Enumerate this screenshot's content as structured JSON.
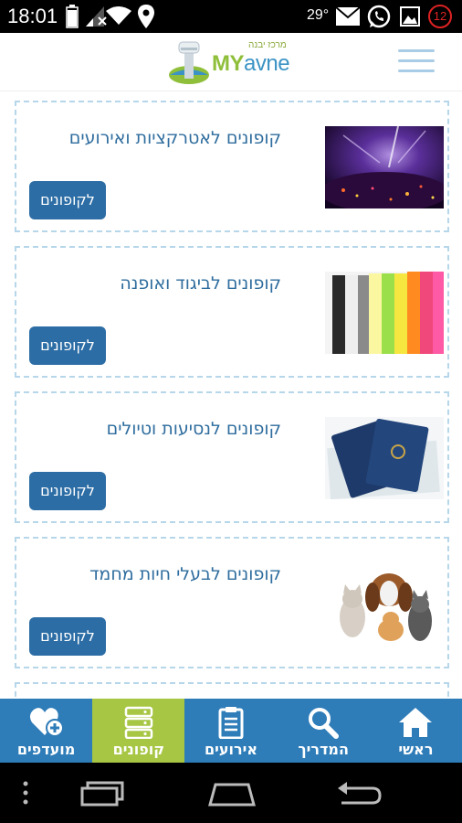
{
  "status_bar": {
    "time": "18:01",
    "temperature": "29°",
    "notification_count": "12"
  },
  "header": {
    "logo_tagline": "מרכז יבנה",
    "logo_brand_my": "MY",
    "logo_brand_avne": "avne"
  },
  "coupons": [
    {
      "title": "קופונים לאטרקציות ואירועים",
      "button_label": "לקופונים",
      "image": "concert-image"
    },
    {
      "title": "קופונים לביגוד ואופנה",
      "button_label": "לקופונים",
      "image": "clothing-image"
    },
    {
      "title": "קופונים לנסיעות וטיולים",
      "button_label": "לקופונים",
      "image": "passports-image"
    },
    {
      "title": "קופונים לבעלי חיות מחמד",
      "button_label": "לקופונים",
      "image": "pets-image"
    }
  ],
  "bottom_nav": [
    {
      "label": "ראשי",
      "icon": "home-icon",
      "active": false
    },
    {
      "label": "המדריך",
      "icon": "search-icon",
      "active": false
    },
    {
      "label": "אירועים",
      "icon": "clipboard-icon",
      "active": false
    },
    {
      "label": "קופונים",
      "icon": "list-icon",
      "active": true
    },
    {
      "label": "מועדפים",
      "icon": "heart-plus-icon",
      "active": false
    }
  ],
  "colors": {
    "primary": "#2e7cb8",
    "active_tab": "#a6c644",
    "button": "#2c6da5",
    "card_border": "#b6d6ea",
    "title_text": "#2f6d9e"
  }
}
